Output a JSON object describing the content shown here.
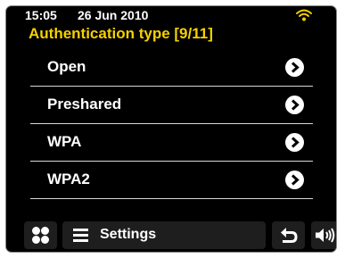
{
  "status_bar": {
    "time": "15:05",
    "date": "26 Jun 2010",
    "wifi_icon": "wifi-icon",
    "wifi_color": "#f5d000"
  },
  "title": "Authentication type [9/11]",
  "list": {
    "items": [
      {
        "label": "Open",
        "icon": "chevron-right-icon"
      },
      {
        "label": "Preshared",
        "icon": "chevron-right-icon"
      },
      {
        "label": "WPA",
        "icon": "chevron-right-icon"
      },
      {
        "label": "WPA2",
        "icon": "chevron-right-icon"
      }
    ]
  },
  "bottom_bar": {
    "menu_icon": "four-dots-menu-icon",
    "settings_icon": "hamburger-icon",
    "settings_label": "Settings",
    "back_icon": "back-arrow-icon",
    "volume_icon": "speaker-volume-icon"
  },
  "colors": {
    "background": "#000000",
    "title": "#f5d000",
    "text": "#ffffff",
    "button": "#1e1e1e",
    "divider": "#d8d8d8"
  }
}
